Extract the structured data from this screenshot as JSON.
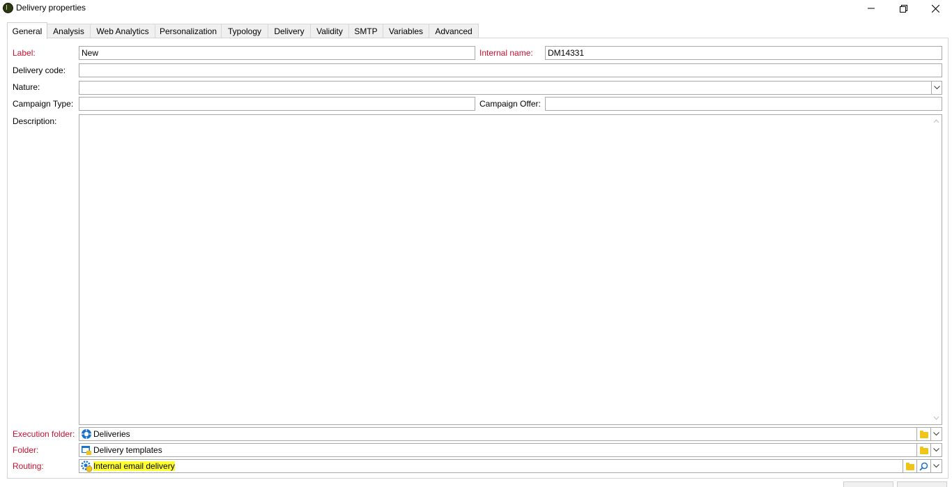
{
  "window": {
    "title": "Delivery properties",
    "icons": {
      "app": "adobe-campaign-icon",
      "minimize": "minimize-icon",
      "restore": "restore-icon",
      "close": "close-icon"
    }
  },
  "tabs": [
    {
      "label": "General",
      "active": true
    },
    {
      "label": "Analysis"
    },
    {
      "label": "Web Analytics"
    },
    {
      "label": "Personalization"
    },
    {
      "label": "Typology"
    },
    {
      "label": "Delivery"
    },
    {
      "label": "Validity"
    },
    {
      "label": "SMTP"
    },
    {
      "label": "Variables"
    },
    {
      "label": "Advanced"
    }
  ],
  "form": {
    "label": {
      "label": "Label:",
      "value": "New",
      "required": true
    },
    "internal_name": {
      "label": "Internal name:",
      "value": "DM14331",
      "required": true
    },
    "delivery_code": {
      "label": "Delivery code:",
      "value": ""
    },
    "nature": {
      "label": "Nature:",
      "value": ""
    },
    "campaign_type": {
      "label": "Campaign Type:",
      "value": ""
    },
    "campaign_offer": {
      "label": "Campaign Offer:",
      "value": ""
    },
    "description": {
      "label": "Description:",
      "value": ""
    },
    "execution_folder": {
      "label": "Execution folder:",
      "value": "Deliveries",
      "icon": "deliveries-folder-icon",
      "required": true
    },
    "folder": {
      "label": "Folder:",
      "value": "Delivery templates",
      "icon": "delivery-templates-folder-icon",
      "required": true
    },
    "routing": {
      "label": "Routing:",
      "value": "Internal email delivery",
      "icon": "routing-gear-icon",
      "required": true,
      "highlighted": true
    }
  },
  "colors": {
    "required_label": "#c8102e",
    "highlight": "#ffff33",
    "folder_icon": "#f0c418",
    "accent_blue": "#1a73c9"
  }
}
